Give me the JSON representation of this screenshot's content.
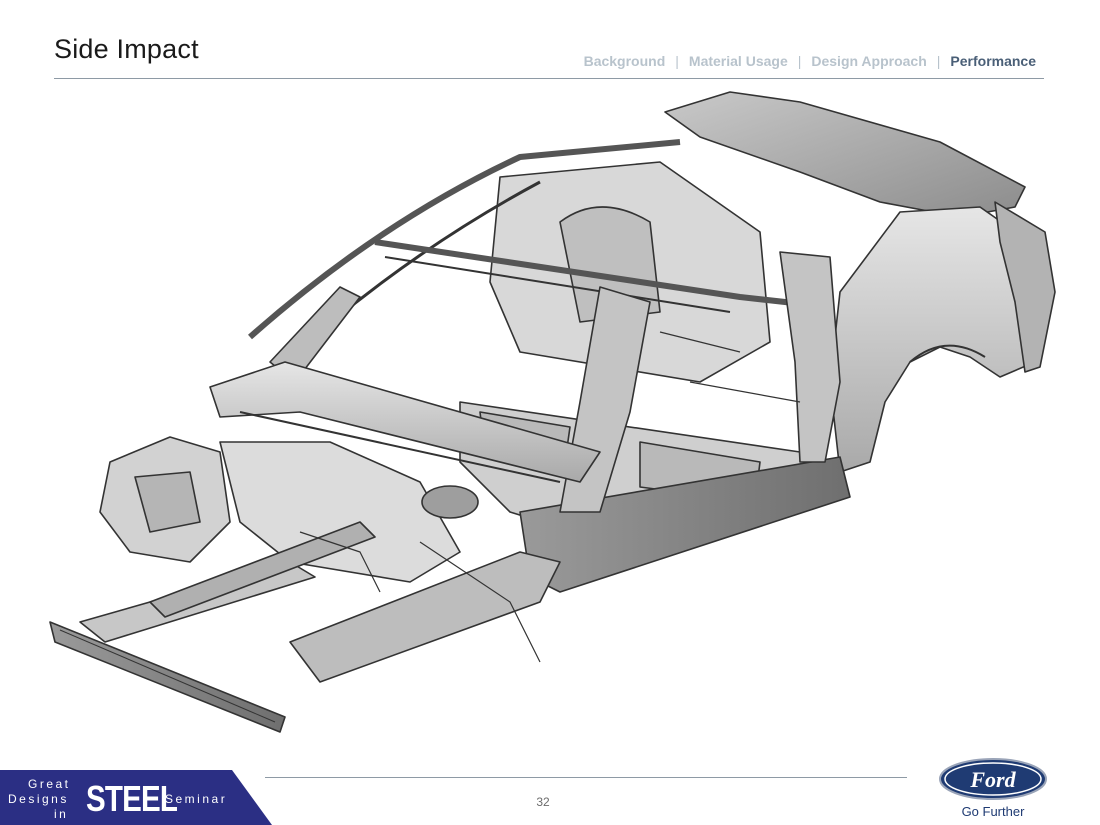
{
  "slide": {
    "title": "Side Impact",
    "page_number": "32"
  },
  "nav": {
    "items": [
      {
        "label": "Background",
        "active": false
      },
      {
        "label": "Material Usage",
        "active": false
      },
      {
        "label": "Design Approach",
        "active": false
      },
      {
        "label": "Performance",
        "active": true
      }
    ],
    "separator": "|",
    "active_color": "#4a5f77",
    "inactive_color": "#b8c3cc"
  },
  "figure": {
    "icon": "car-body-in-white-illustration"
  },
  "footer": {
    "banner": {
      "great": "Great",
      "designs": "Designs",
      "in": "in",
      "steel": "STEEL",
      "seminar": "Seminar",
      "color": "#2b2f84"
    },
    "brand": {
      "logo_text": "Ford",
      "tagline": "Go Further",
      "color": "#1f3b73"
    }
  }
}
